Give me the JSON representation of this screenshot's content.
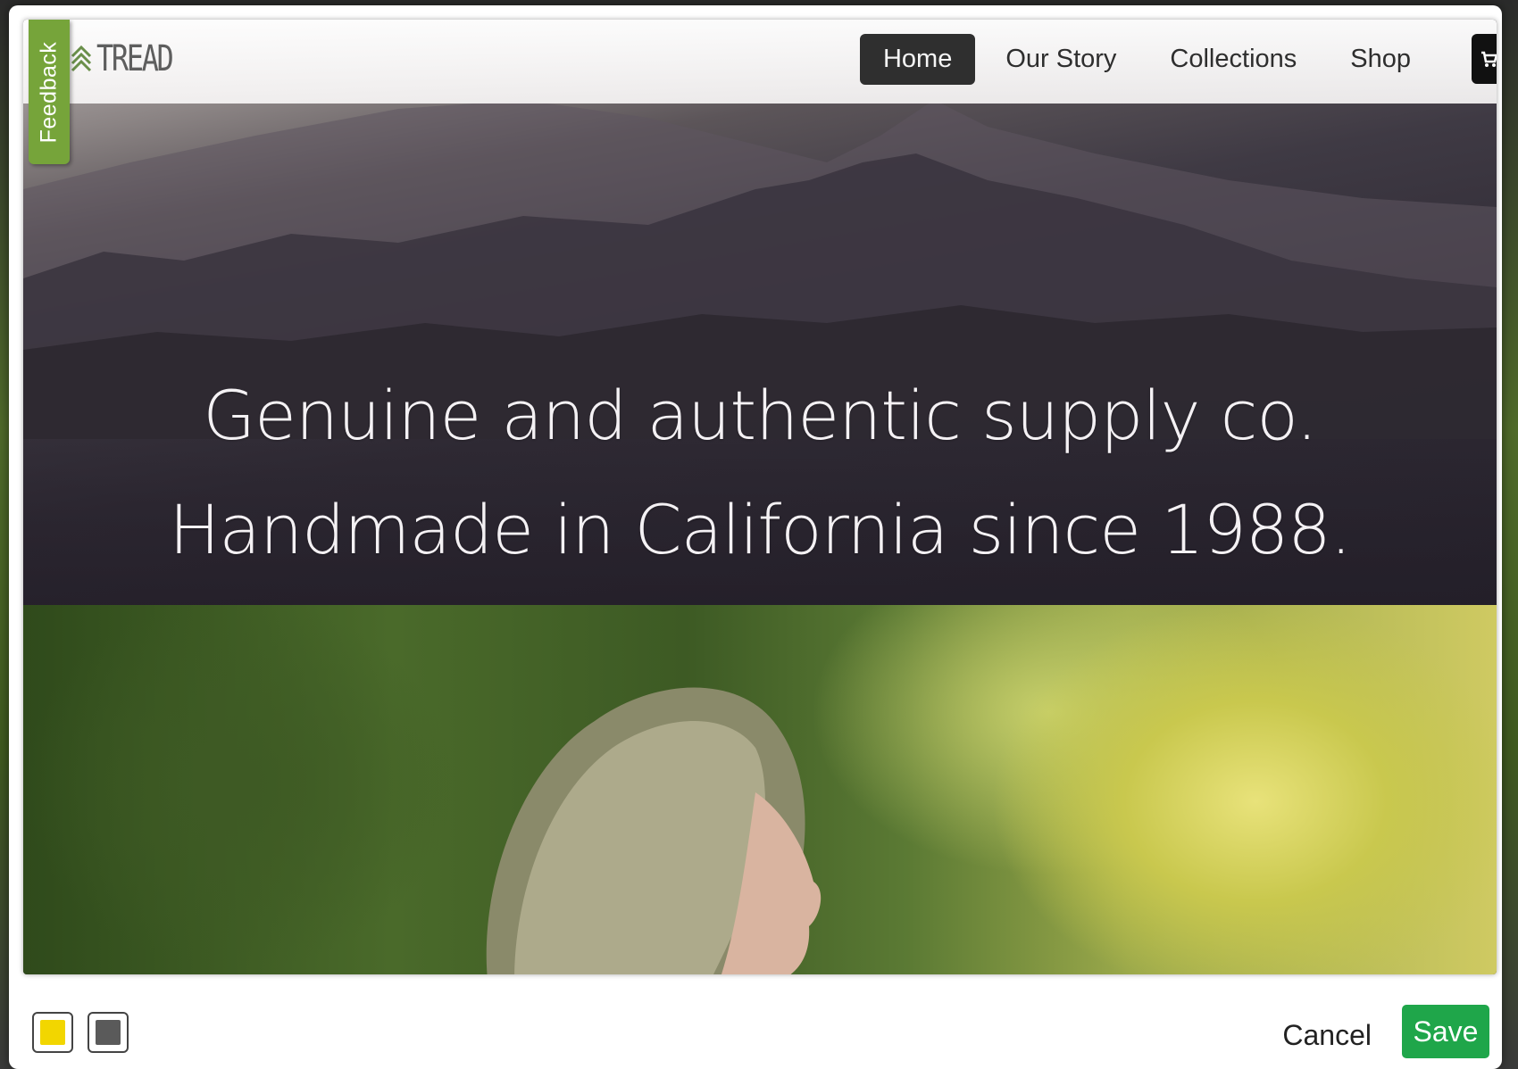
{
  "feedback_tab": {
    "label": "Feedback"
  },
  "site": {
    "logo_text": "TREAD",
    "nav": [
      {
        "label": "Home",
        "active": true
      },
      {
        "label": "Our Story",
        "active": false
      },
      {
        "label": "Collections",
        "active": false
      },
      {
        "label": "Shop",
        "active": false
      }
    ],
    "cart_icon": "cart-icon",
    "hero": {
      "line1": "Genuine and authentic supply co.",
      "line2": "Handmade in California since 1988."
    }
  },
  "toolbar": {
    "swatches": [
      {
        "name": "yellow",
        "color": "#f2d600"
      },
      {
        "name": "gray",
        "color": "#5a5a5a"
      }
    ],
    "cancel_label": "Cancel",
    "save_label": "Save",
    "accent_color": "#1fa64a"
  }
}
